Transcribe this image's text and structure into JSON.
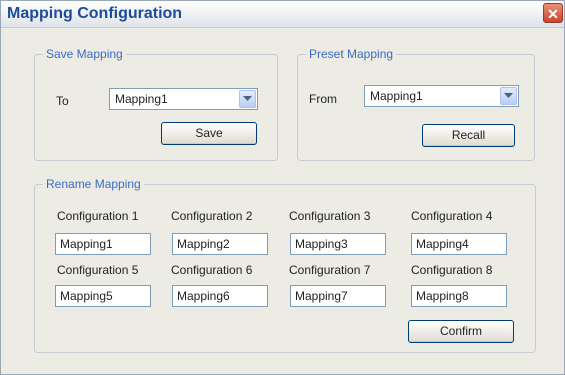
{
  "window": {
    "title": "Mapping Configuration",
    "close_glyph": "✕"
  },
  "save_mapping": {
    "legend": "Save Mapping",
    "to_label": "To",
    "selected": "Mapping1",
    "button": "Save"
  },
  "preset_mapping": {
    "legend": "Preset Mapping",
    "from_label": "From",
    "selected": "Mapping1",
    "button": "Recall"
  },
  "rename_mapping": {
    "legend": "Rename Mapping",
    "configs": [
      {
        "label": "Configuration 1",
        "value": "Mapping1"
      },
      {
        "label": "Configuration 2",
        "value": "Mapping2"
      },
      {
        "label": "Configuration 3",
        "value": "Mapping3"
      },
      {
        "label": "Configuration 4",
        "value": "Mapping4"
      },
      {
        "label": "Configuration 5",
        "value": "Mapping5"
      },
      {
        "label": "Configuration 6",
        "value": "Mapping6"
      },
      {
        "label": "Configuration 7",
        "value": "Mapping7"
      },
      {
        "label": "Configuration 8",
        "value": "Mapping8"
      }
    ],
    "button": "Confirm"
  }
}
